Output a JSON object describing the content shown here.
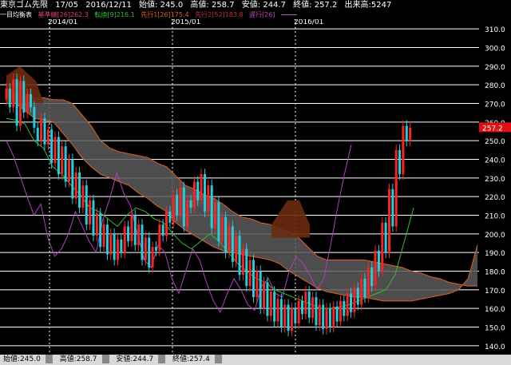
{
  "header": {
    "symbol": "東京ゴム先限",
    "contract": "17/05",
    "date": "2016/12/11",
    "open": "始値: 245.0",
    "high": "高値: 258.7",
    "low": "安値: 244.7",
    "close": "終値: 257.2",
    "volume": "出来高:5247"
  },
  "legend": {
    "title": "一目均衡表",
    "kijun": "基準線[26]262.3",
    "tenkan": "転換[9]216.1",
    "senko1": "先行1[26]175.4",
    "senko2": "先行2[52]183.8",
    "chikou": "遅行[26]",
    "colors": {
      "kijun": "#e0407a",
      "tenkan": "#2fbf2f",
      "senko1": "#e06020",
      "senko2": "#b02030",
      "chikou": "#c040c0"
    }
  },
  "footer": {
    "open": "始値:245.0",
    "high": "高値:258.7",
    "low": "安値:244.7",
    "close": "終値:257.4"
  },
  "chart_data": {
    "type": "candlestick",
    "x_labels": [
      "2014/01",
      "2015/01",
      "2016/01"
    ],
    "y_ticks": [
      140,
      150,
      160,
      170,
      180,
      190,
      200,
      210,
      220,
      230,
      240,
      250,
      260,
      270,
      280,
      290,
      300,
      310
    ],
    "y_tick_labels": [
      "140.0",
      "150.0",
      "160.0",
      "170.0",
      "180.0",
      "190.0",
      "200.0",
      "210.0",
      "220.0",
      "230.0",
      "240.0",
      "250.0",
      "260.0",
      "270.0",
      "280.0",
      "290.0",
      "300.0",
      "310.0"
    ],
    "ylim": [
      135,
      315
    ],
    "last_price": 257.2,
    "last_price_label": "257.2",
    "colors": {
      "up": "#ff2020",
      "down": "#20d0e0",
      "cloud_fill": "#5a5a5a",
      "cloud_fill_red": "#6a2a10",
      "span1": "#e06020",
      "span2": "#b02030",
      "kijun": "#e0407a",
      "tenkan": "#2fbf2f",
      "chikou": "#b040c0",
      "purple_ma": "#6040c0",
      "grid": "#ffffff"
    },
    "price_path": [
      272,
      278,
      268,
      283,
      258,
      282,
      265,
      275,
      268,
      257,
      250,
      262,
      248,
      256,
      238,
      252,
      232,
      247,
      228,
      240,
      219,
      233,
      214,
      226,
      205,
      218,
      199,
      211,
      193,
      205,
      189,
      200,
      186,
      197,
      190,
      204,
      196,
      210,
      194,
      205,
      186,
      198,
      182,
      193,
      191,
      205,
      199,
      212,
      206,
      221,
      210,
      225,
      204,
      218,
      214,
      228,
      218,
      232,
      212,
      226,
      203,
      217,
      196,
      209,
      190,
      204,
      185,
      199,
      178,
      192,
      172,
      186,
      166,
      180,
      160,
      174,
      156,
      169,
      153,
      165,
      150,
      162,
      148,
      160,
      152,
      164,
      157,
      169,
      155,
      166,
      151,
      162,
      149,
      160,
      150,
      161,
      153,
      164,
      156,
      168,
      158,
      171,
      162,
      176,
      166,
      182,
      172,
      191,
      180,
      206,
      190,
      224,
      204,
      245,
      232,
      258,
      250,
      257
    ],
    "cloud_top": [
      278,
      276,
      274,
      273,
      273,
      272,
      272,
      270,
      264,
      258,
      250,
      246,
      244,
      243,
      242,
      241,
      238,
      236,
      231,
      226,
      224,
      221,
      219,
      216,
      212,
      209,
      208,
      206,
      205,
      203,
      201,
      198,
      193,
      188,
      186,
      186,
      186,
      186,
      186,
      185,
      184,
      183,
      182,
      180,
      179,
      177,
      176,
      174,
      173,
      172,
      172
    ],
    "cloud_bot": [
      276,
      270,
      266,
      262,
      261,
      260,
      254,
      248,
      241,
      236,
      232,
      230,
      228,
      226,
      222,
      219,
      215,
      212,
      206,
      202,
      199,
      196,
      193,
      191,
      190,
      189,
      188,
      187,
      186,
      184,
      180,
      177,
      174,
      171,
      169,
      168,
      167,
      166,
      166,
      165,
      164,
      164,
      164,
      164,
      165,
      166,
      167,
      168,
      170,
      176,
      194
    ],
    "chikou_path": [
      250,
      242,
      231,
      220,
      210,
      216,
      198,
      188,
      192,
      200,
      212,
      204,
      196,
      190,
      208,
      219,
      233,
      222,
      215,
      200,
      186,
      182,
      194,
      190,
      176,
      168,
      180,
      192,
      186,
      174,
      164,
      158,
      168,
      176,
      170,
      162,
      159,
      172,
      176,
      168,
      166,
      180,
      188,
      184,
      178,
      170,
      176,
      194,
      214,
      232,
      248
    ],
    "tenkan_path": [
      262,
      261,
      259,
      250,
      246,
      236,
      232,
      226,
      221,
      214,
      212,
      208,
      204,
      210,
      214,
      212,
      208,
      206,
      200,
      195,
      192,
      196,
      200,
      196,
      190,
      184,
      180,
      176,
      174,
      170,
      168,
      166,
      164,
      162,
      160,
      160,
      161,
      162,
      164,
      166,
      168,
      170,
      178,
      196,
      214
    ]
  }
}
